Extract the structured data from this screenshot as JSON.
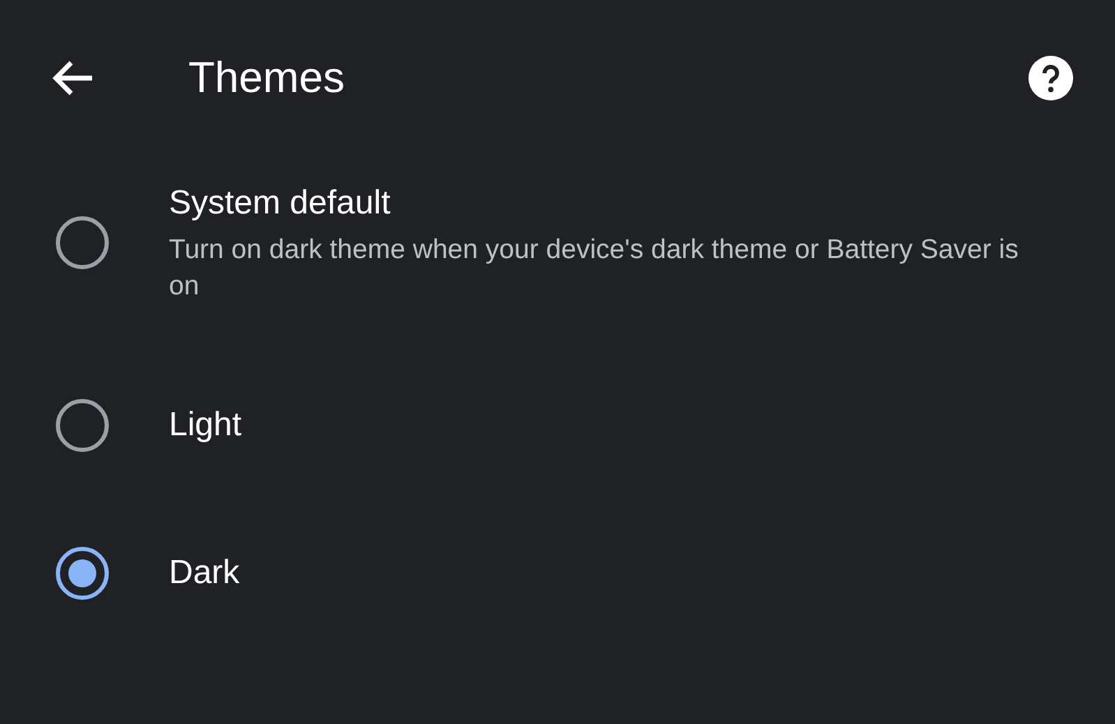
{
  "header": {
    "title": "Themes"
  },
  "options": [
    {
      "label": "System default",
      "description": "Turn on dark theme when your device's dark theme or Battery Saver is on",
      "selected": false
    },
    {
      "label": "Light",
      "selected": false
    },
    {
      "label": "Dark",
      "selected": true
    }
  ]
}
